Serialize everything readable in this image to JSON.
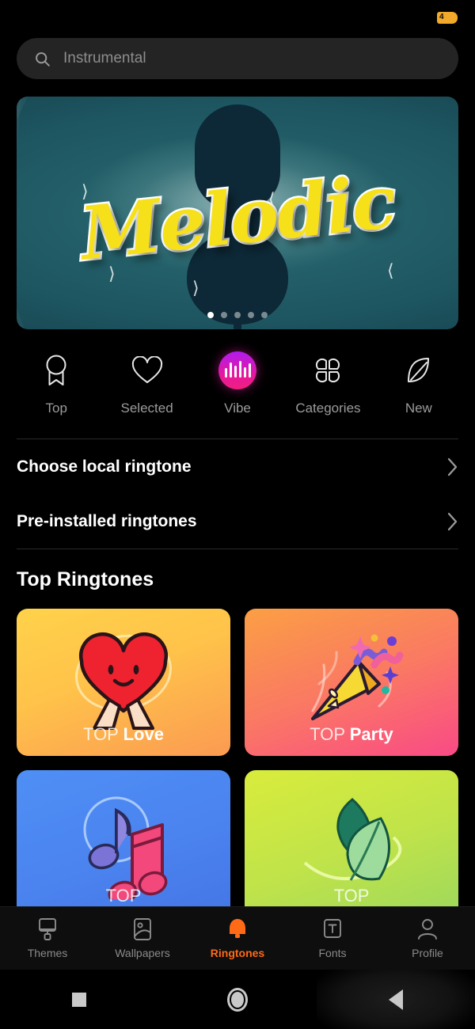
{
  "statusbar": {
    "battery_level": "4",
    "battery_icon": "battery-charging-icon"
  },
  "search": {
    "placeholder": "Instrumental",
    "value": "",
    "icon": "search-icon"
  },
  "banner": {
    "title": "Melodic",
    "image_subject": "cello-silhouette-underwater",
    "dots_total": 5,
    "dots_active_index": 0
  },
  "quick_categories": [
    {
      "label": "Top",
      "icon": "award-badge-icon",
      "active": false
    },
    {
      "label": "Selected",
      "icon": "heart-icon",
      "active": false
    },
    {
      "label": "Vibe",
      "icon": "waveform-icon",
      "active": true
    },
    {
      "label": "Categories",
      "icon": "four-petal-icon",
      "active": false
    },
    {
      "label": "New",
      "icon": "leaf-icon",
      "active": false
    }
  ],
  "list_rows": [
    {
      "label": "Choose local ringtone",
      "chevron": "chevron-right-icon"
    },
    {
      "label": "Pre-installed ringtones",
      "chevron": "chevron-right-icon"
    }
  ],
  "top_ringtones": {
    "title": "Top Ringtones",
    "cards": [
      {
        "prefix": "TOP",
        "name": "Love",
        "art": "heart-with-hands-icon",
        "theme": "c-love"
      },
      {
        "prefix": "TOP",
        "name": "Party",
        "art": "party-popper-icon",
        "theme": "c-party"
      },
      {
        "prefix": "TOP",
        "name": "",
        "art": "music-notes-icon",
        "theme": "c-music"
      },
      {
        "prefix": "TOP",
        "name": "",
        "art": "leaves-icon",
        "theme": "c-nature"
      }
    ]
  },
  "bottom_nav": [
    {
      "label": "Themes",
      "icon": "paint-brush-icon",
      "active": false
    },
    {
      "label": "Wallpapers",
      "icon": "image-icon",
      "active": false
    },
    {
      "label": "Ringtones",
      "icon": "bell-icon",
      "active": true
    },
    {
      "label": "Fonts",
      "icon": "text-box-icon",
      "active": false
    },
    {
      "label": "Profile",
      "icon": "person-icon",
      "active": false
    }
  ],
  "system_nav": [
    {
      "name": "recents-button",
      "icon": "square-icon",
      "pressed": false
    },
    {
      "name": "home-button",
      "icon": "circle-icon",
      "pressed": false
    },
    {
      "name": "back-button",
      "icon": "triangle-icon",
      "pressed": true
    }
  ],
  "colors": {
    "accent": "#ff6a17",
    "vibe_gradient_start": "#b01cf0",
    "vibe_gradient_end": "#f01f7f",
    "battery": "#f0a92b",
    "background": "#000000"
  }
}
